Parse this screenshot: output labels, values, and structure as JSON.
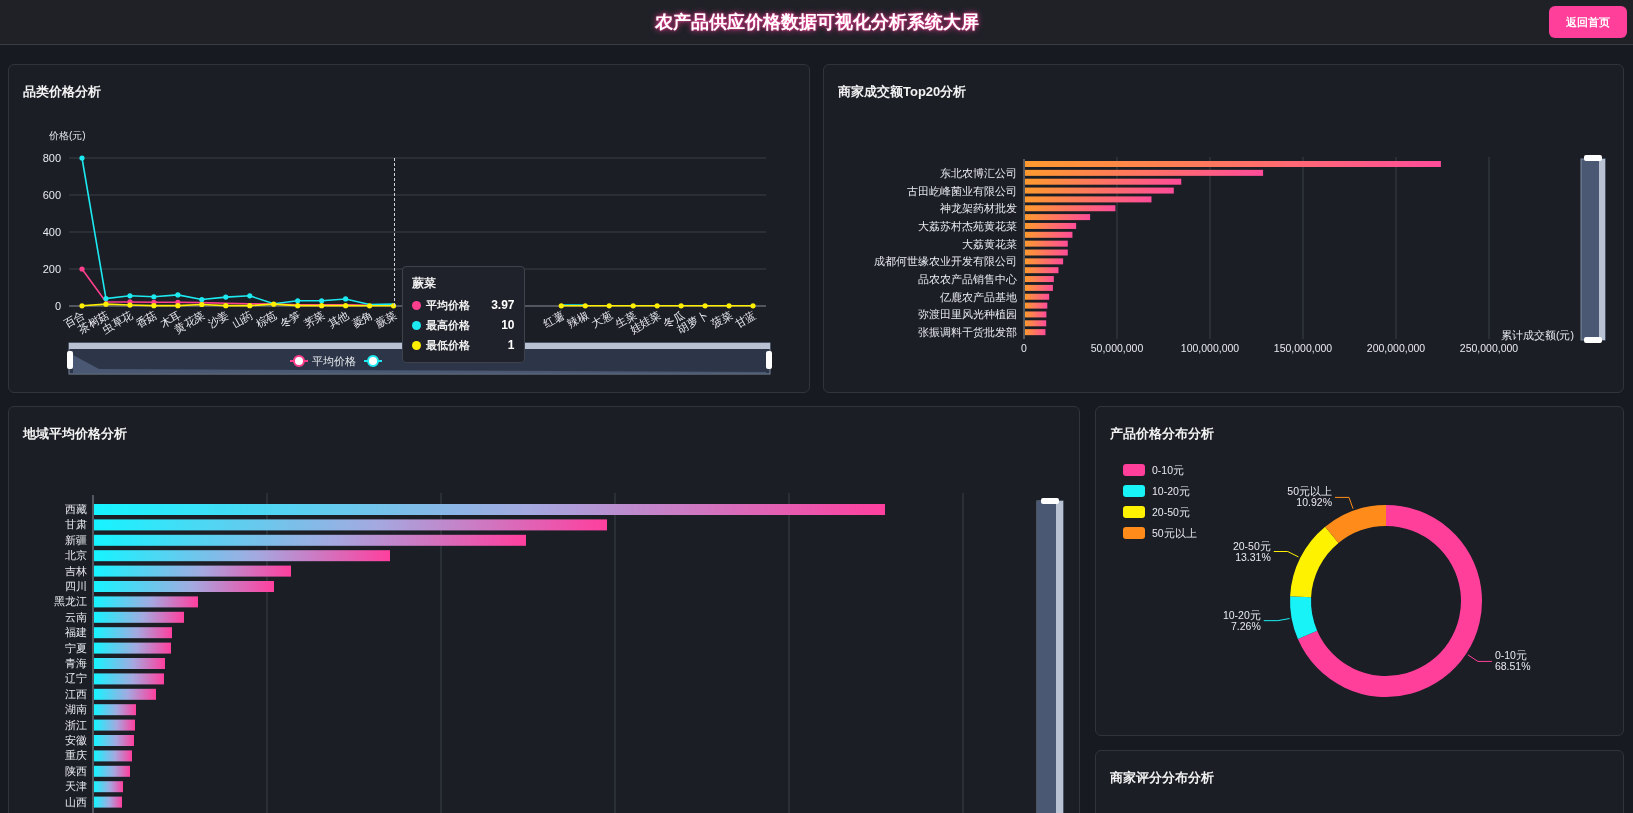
{
  "header": {
    "title": "农产品供应价格数据可视化分析系统大屏",
    "back_button": "返回首页"
  },
  "category_price": {
    "title": "品类价格分析",
    "chart_data": {
      "type": "line",
      "ylabel": "价格(元)",
      "yticks": [
        0,
        200,
        400,
        600,
        800
      ],
      "ylim": [
        0,
        800
      ],
      "grid": true,
      "legend": true,
      "categories": [
        "百合",
        "茶树菇",
        "虫草花",
        "香菇",
        "木耳",
        "黄花菜",
        "沙姜",
        "山药",
        "棕苞",
        "冬笋",
        "荠菜",
        "其他",
        "菱角",
        "蕨菜",
        null,
        null,
        null,
        null,
        null,
        null,
        "红薯",
        "辣椒",
        "大葱",
        "生菜",
        "娃娃菜",
        "冬瓜",
        "胡萝卜",
        "菠菜",
        "甘蓝"
      ],
      "series": [
        {
          "name": "平均价格",
          "color": "#ff3f8e",
          "values": [
            200,
            22,
            22,
            20,
            20,
            18,
            15,
            12,
            10,
            6,
            6,
            6,
            4,
            null,
            null,
            null,
            null,
            null,
            null,
            null,
            null,
            null,
            null,
            null,
            null,
            null,
            null,
            null,
            null
          ]
        },
        {
          "name": "最高价格",
          "color": "#1de9f0",
          "values": [
            800,
            40,
            55,
            50,
            60,
            35,
            48,
            55,
            12,
            28,
            28,
            38,
            8,
            10,
            null,
            null,
            null,
            null,
            null,
            null,
            5,
            5,
            null,
            null,
            null,
            null,
            null,
            null,
            null
          ]
        },
        {
          "name": "最低价格",
          "color": "#ffee00",
          "values": [
            1,
            10,
            5,
            2,
            2,
            8,
            2,
            2,
            10,
            2,
            2,
            2,
            1,
            1,
            null,
            null,
            null,
            null,
            null,
            null,
            1,
            1,
            1,
            1,
            1,
            1,
            1,
            1,
            1
          ]
        }
      ]
    },
    "legend": [
      {
        "label": "平均价格",
        "color": "#ff3f8e"
      },
      {
        "color": "#1de9f0"
      }
    ],
    "tooltip": {
      "title": "蕨菜",
      "values": [
        "3.97",
        "10",
        "1"
      ]
    }
  },
  "merchant_top20": {
    "title": "商家成交额Top20分析",
    "chart_data": {
      "type": "bar",
      "orientation": "horizontal",
      "xlabel": "累计成交额(元)",
      "xlim": [
        0,
        250000000
      ],
      "grid": true,
      "xticks": [
        {
          "value": 0,
          "label": "0"
        },
        {
          "value": 50000000,
          "label": "50,000,000"
        },
        {
          "value": 100000000,
          "label": "100,000,000"
        },
        {
          "value": 150000000,
          "label": "150,000,000"
        },
        {
          "value": 200000000,
          "label": "200,000,000"
        },
        {
          "value": 250000000,
          "label": "250,000,000"
        }
      ],
      "categories": [
        null,
        "东北农博汇公司",
        null,
        "古田屹峰菌业有限公司",
        null,
        "神龙架药材批发",
        null,
        "大荔苏村杰苑黄花菜",
        null,
        "大荔黄花菜",
        null,
        "成都何世缘农业开发有限公司",
        null,
        "品农农产品销售中心",
        null,
        "亿鹿农产品基地",
        null,
        "弥渡田里风光种植园",
        null,
        "张振调料干货批发部"
      ],
      "values": [
        223600000,
        128000000,
        84000000,
        80000000,
        68000000,
        48600000,
        35000000,
        27500000,
        25500000,
        23000000,
        23000000,
        20500000,
        18000000,
        15500000,
        15000000,
        13000000,
        12000000,
        11500000,
        11400000,
        11000000
      ]
    }
  },
  "region_price": {
    "title": "地域平均价格分析",
    "zoom_slider": {
      "level": 1
    },
    "regions": [
      "西藏",
      "甘肃",
      "新疆",
      "北京",
      "吉林",
      "四川",
      "黑龙江",
      "云南",
      "福建",
      "宁夏",
      "青海",
      "辽宁",
      "江西",
      "湖南",
      "浙江",
      "安徽",
      "重庆",
      "陕西",
      "天津",
      "山西"
    ]
  },
  "price_distribution": {
    "title": "产品价格分布分析",
    "chart_data": {
      "type": "donut",
      "legend": true,
      "value_labels": [
        "68.51%",
        "7.26%",
        "13.31%",
        "10.92%"
      ],
      "categories": [
        "0-10元",
        "10-20元",
        "20-50元",
        "50元以上"
      ],
      "series": [
        {
          "values": [
            68.51,
            7.26,
            13.31,
            10.92
          ]
        }
      ],
      "colors": [
        "#ff3f9a",
        "#17f3f7",
        "#fff200",
        "#ff8c1a"
      ]
    }
  },
  "merchant_rating": {
    "title": "商家评分分布分析"
  }
}
